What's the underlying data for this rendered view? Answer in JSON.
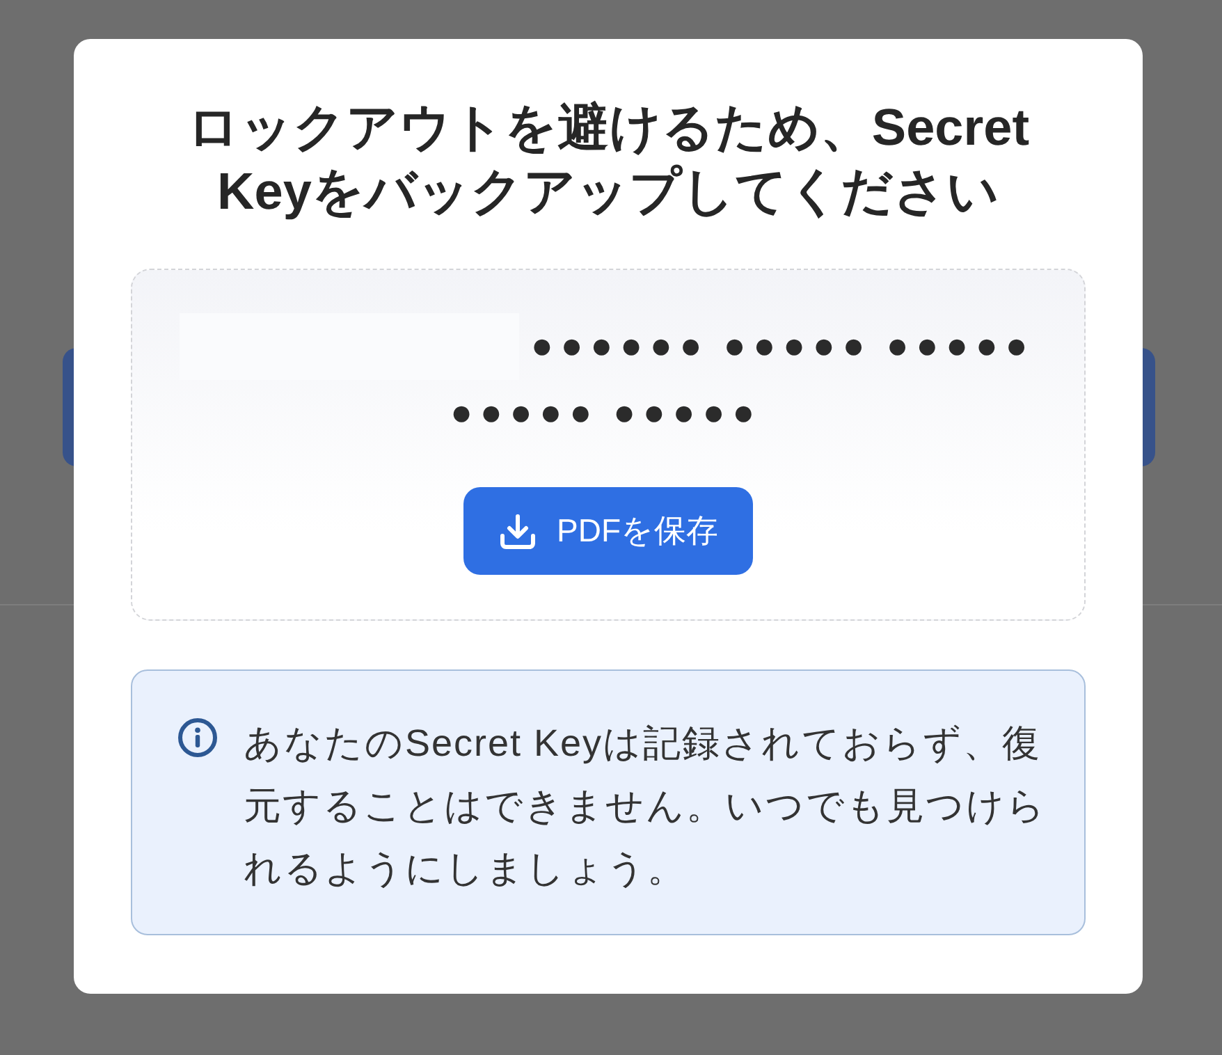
{
  "dialog": {
    "title": "ロックアウトを避けるため、Secret Keyをバックアップしてください",
    "secret_key": {
      "redacted": true,
      "masked_value": "●●●●●● ●●●●● ●●●●● ●●●●● ●●●●●"
    },
    "save_button": {
      "label": "PDFを保存"
    },
    "notice": {
      "text": "あなたのSecret Keyは記録されておらず、復元することはできません。いつでも見つけられるようにしましょう。"
    }
  }
}
